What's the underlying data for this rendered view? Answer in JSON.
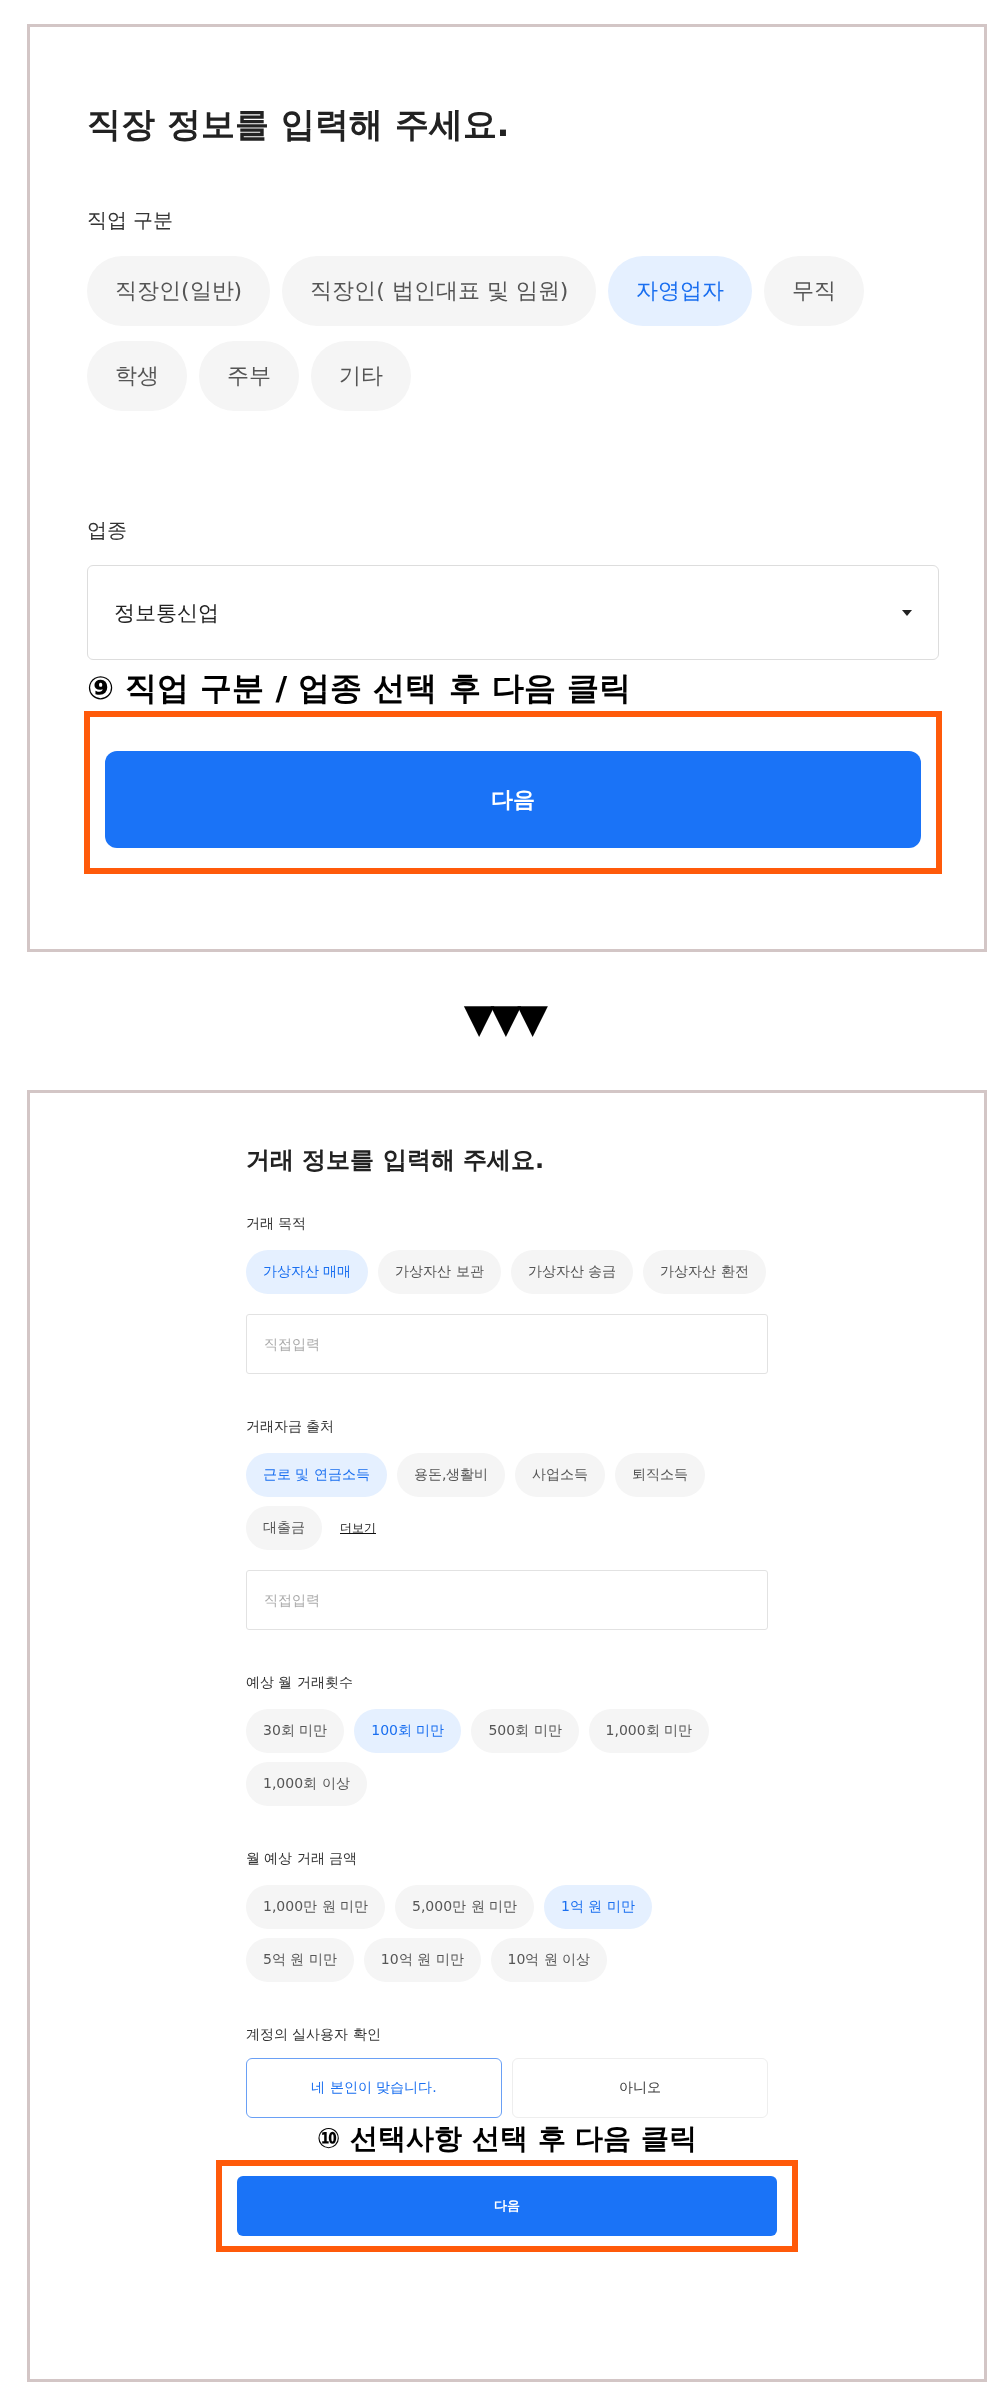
{
  "screens": [
    {
      "title": "직장 정보를 입력해 주세요.",
      "sections": [
        {
          "kind": "chips",
          "label": "직업 구분",
          "options": [
            {
              "label": "직장인(일반)",
              "selected": false
            },
            {
              "label": "직장인( 법인대표 및 임원)",
              "selected": false
            },
            {
              "label": "자영업자",
              "selected": true
            },
            {
              "label": "무직",
              "selected": false
            },
            {
              "label": "학생",
              "selected": false
            },
            {
              "label": "주부",
              "selected": false
            },
            {
              "label": "기타",
              "selected": false
            }
          ]
        },
        {
          "kind": "select",
          "label": "업종",
          "value": "정보통신업"
        }
      ],
      "annotation": "⑨ 직업 구분 / 업종 선택 후 다음 클릭",
      "next_button": "다음"
    },
    {
      "title": "거래 정보를 입력해 주세요.",
      "sections": [
        {
          "kind": "chips",
          "label": "거래 목적",
          "options": [
            {
              "label": "가상자산 매매",
              "selected": true
            },
            {
              "label": "가상자산 보관",
              "selected": false
            },
            {
              "label": "가상자산 송금",
              "selected": false
            },
            {
              "label": "가상자산 환전",
              "selected": false
            }
          ],
          "placeholder": "직접입력"
        },
        {
          "kind": "chips",
          "label": "거래자금 출처",
          "options": [
            {
              "label": "근로 및 연금소득",
              "selected": true
            },
            {
              "label": "용돈,생활비",
              "selected": false
            },
            {
              "label": "사업소득",
              "selected": false
            },
            {
              "label": "퇴직소득",
              "selected": false
            },
            {
              "label": "대출금",
              "selected": false
            }
          ],
          "more_link": "더보기",
          "placeholder": "직접입력"
        },
        {
          "kind": "chips",
          "label": "예상 월 거래횟수",
          "options": [
            {
              "label": "30회 미만",
              "selected": false
            },
            {
              "label": "100회 미만",
              "selected": true
            },
            {
              "label": "500회 미만",
              "selected": false
            },
            {
              "label": "1,000회 미만",
              "selected": false
            },
            {
              "label": "1,000회 이상",
              "selected": false
            }
          ]
        },
        {
          "kind": "chips",
          "label": "월 예상 거래 금액",
          "options": [
            {
              "label": "1,000만 원 미만",
              "selected": false
            },
            {
              "label": "5,000만 원 미만",
              "selected": false
            },
            {
              "label": "1억 원 미만",
              "selected": true
            },
            {
              "label": "5억 원 미만",
              "selected": false
            },
            {
              "label": "10억 원 미만",
              "selected": false
            },
            {
              "label": "10억 원 이상",
              "selected": false
            }
          ]
        },
        {
          "kind": "choice",
          "label": "계정의 실사용자 확인",
          "options": [
            {
              "label": "네 본인이 맞습니다.",
              "selected": true
            },
            {
              "label": "아니오",
              "selected": false
            }
          ]
        }
      ],
      "annotation": "⑩ 선택사항 선택 후 다음 클릭",
      "next_button": "다음"
    }
  ],
  "separator": "▼▼▼"
}
